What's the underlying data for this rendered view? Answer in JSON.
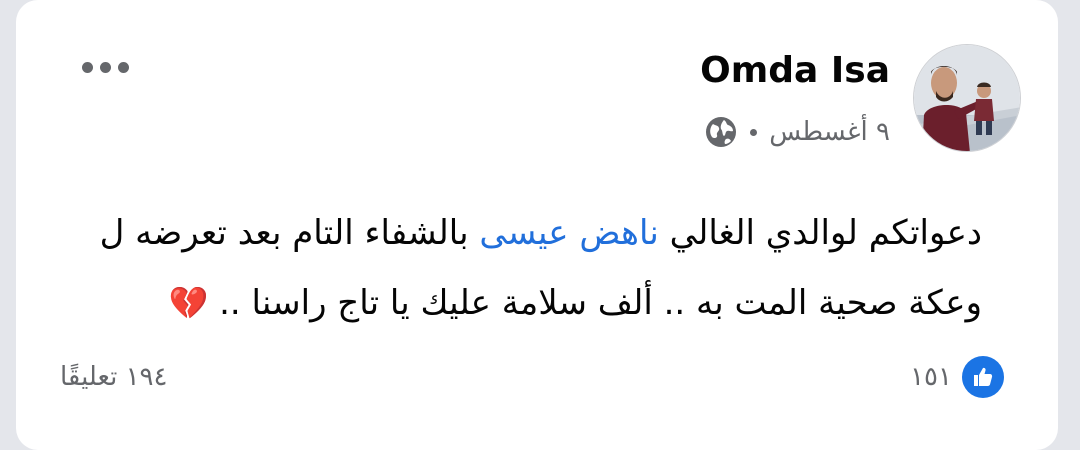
{
  "post": {
    "author": "Omda Isa",
    "timestamp": "٩ أغسطس",
    "audience_icon": "globe-icon",
    "more_icon": "more-options-icon",
    "text_before": "دعواتكم لوالدي الغالي ",
    "mention": "ناهض عيسى",
    "text_after": " بالشفاء التام بعد تعرضه ل وعكة صحية المت به .. ألف سلامة عليك يا تاج راسنا .. ",
    "emoji": "💔",
    "emoji_name": "broken-heart-icon"
  },
  "footer": {
    "reaction_icon": "like-icon",
    "reaction_count": "١٥١",
    "comments": "١٩٤ تعليقًا"
  },
  "colors": {
    "accent": "#1b74e4",
    "mention": "#216fdb",
    "secondary_text": "#65676b",
    "background": "#e4e6eb"
  }
}
